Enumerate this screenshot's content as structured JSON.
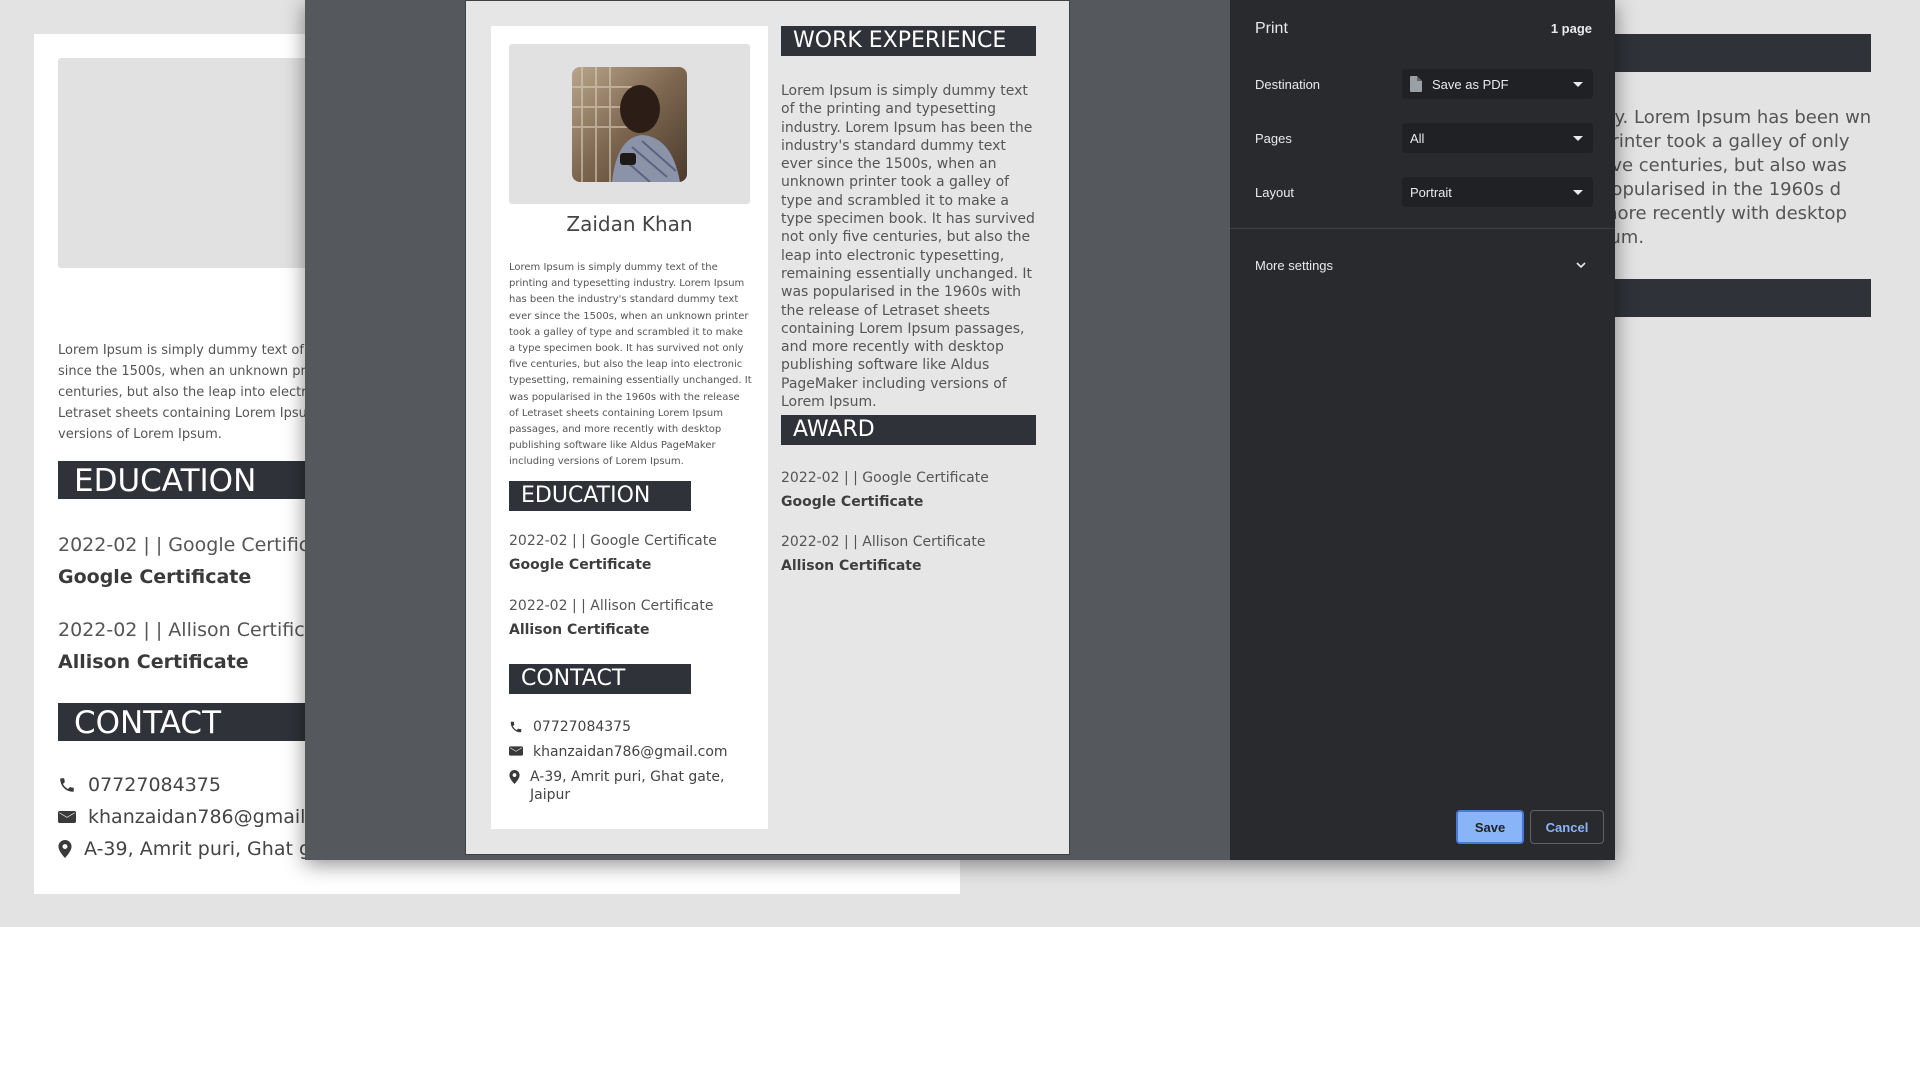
{
  "background": {
    "about_lines": [
      "Lorem Ipsum is simply dummy text of the printing and typesetting industry.",
      "since the 1500s, when an unknown printer took a galley of type",
      "centuries, but also the leap into electronic typesetting",
      "Letraset sheets containing Lorem Ipsum passages",
      "versions of Lorem Ipsum."
    ],
    "education_heading": "EDUCATION",
    "education": [
      {
        "line": "2022-02 | | Google Certificate",
        "title": "Google Certificate"
      },
      {
        "line": "2022-02 | | Allison Certificate",
        "title": "Allison Certificate"
      }
    ],
    "contact_heading": "CONTACT",
    "phone": "07727084375",
    "email": "khanzaidan786@gmail.com",
    "address": "A-39, Amrit puri, Ghat gate, Jaipur",
    "right_para": "try. Lorem Ipsum has been wn printer took a galley of only five centuries, but also was popularised in the 1960s d more recently with desktop sum."
  },
  "preview": {
    "name": "Zaidan Khan",
    "about": "Lorem Ipsum is simply dummy text of the printing and typesetting industry. Lorem Ipsum has been the industry's standard dummy text ever since the 1500s, when an unknown printer took a galley of type and scrambled it to make a type specimen book. It has survived not only five centuries, but also the leap into electronic typesetting, remaining essentially unchanged. It was popularised in the 1960s with the release of Letraset sheets containing Lorem Ipsum passages, and more recently with desktop publishing software like Aldus PageMaker including versions of Lorem Ipsum.",
    "education_heading": "EDUCATION",
    "education": [
      {
        "line": "2022-02 | | Google Certificate",
        "title": "Google Certificate"
      },
      {
        "line": "2022-02 | | Allison Certificate",
        "title": "Allison Certificate"
      }
    ],
    "contact_heading": "CONTACT",
    "phone": "07727084375",
    "email": "khanzaidan786@gmail.com",
    "address": "A-39, Amrit puri, Ghat gate, Jaipur",
    "work_heading": "WORK EXPERIENCE",
    "work_text": "Lorem Ipsum is simply dummy text of the printing and typesetting industry. Lorem Ipsum has been the industry's standard dummy text ever since the 1500s, when an unknown printer took a galley of type and scrambled it to make a type specimen book. It has survived not only five centuries, but also the leap into electronic typesetting, remaining essentially unchanged. It was popularised in the 1960s with the release of Letraset sheets containing Lorem Ipsum passages, and more recently with desktop publishing software like Aldus PageMaker including versions of Lorem Ipsum.",
    "award_heading": "AWARD",
    "awards": [
      {
        "line": "2022-02 | | Google Certificate",
        "title": "Google Certificate"
      },
      {
        "line": "2022-02 | | Allison Certificate",
        "title": "Allison Certificate"
      }
    ]
  },
  "print": {
    "title": "Print",
    "page_count": "1 page",
    "destination_label": "Destination",
    "destination_value": "Save as PDF",
    "pages_label": "Pages",
    "pages_value": "All",
    "layout_label": "Layout",
    "layout_value": "Portrait",
    "more_settings": "More settings",
    "save": "Save",
    "cancel": "Cancel"
  },
  "icons": [
    "phone-icon",
    "envelope-icon",
    "map-pin-icon",
    "file-icon",
    "chevron-down-icon"
  ],
  "colors": {
    "heading_bar": "#2f3238",
    "dialog_panel": "#292a2d",
    "accent": "#8ab4f8"
  }
}
